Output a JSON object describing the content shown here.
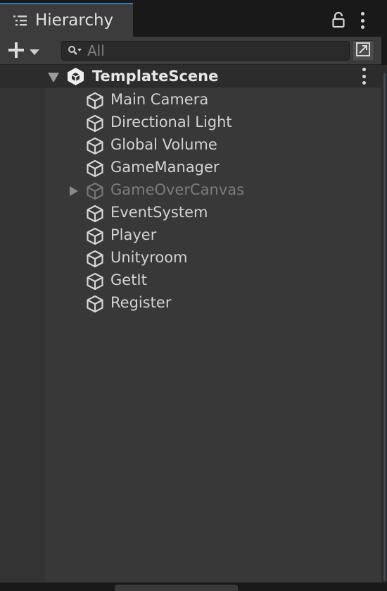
{
  "tab": {
    "title": "Hierarchy",
    "icon": "hierarchy-list-icon"
  },
  "header_icons": {
    "lock": "lock-icon",
    "menu": "kebab-menu-icon"
  },
  "toolbar": {
    "add_icon": "plus-icon",
    "dropdown_icon": "triangle-down-icon",
    "search": {
      "placeholder": "All",
      "value": "",
      "icon": "search-icon"
    },
    "scene_view_icon": "scene-view-icon"
  },
  "scene": {
    "name": "TemplateScene",
    "expanded": true,
    "icon": "unity-scene-icon"
  },
  "objects": [
    {
      "label": "Main Camera",
      "active": true,
      "has_children": false,
      "icon": "gameobject-cube-icon"
    },
    {
      "label": "Directional Light",
      "active": true,
      "has_children": false,
      "icon": "gameobject-cube-icon"
    },
    {
      "label": "Global Volume",
      "active": true,
      "has_children": false,
      "icon": "gameobject-cube-icon"
    },
    {
      "label": "GameManager",
      "active": true,
      "has_children": false,
      "icon": "gameobject-cube-icon"
    },
    {
      "label": "GameOverCanvas",
      "active": false,
      "has_children": true,
      "icon": "gameobject-cube-icon"
    },
    {
      "label": "EventSystem",
      "active": true,
      "has_children": false,
      "icon": "gameobject-cube-icon"
    },
    {
      "label": "Player",
      "active": true,
      "has_children": false,
      "icon": "gameobject-cube-icon"
    },
    {
      "label": "Unityroom",
      "active": true,
      "has_children": false,
      "icon": "gameobject-cube-icon"
    },
    {
      "label": "GetIt",
      "active": true,
      "has_children": false,
      "icon": "gameobject-cube-icon"
    },
    {
      "label": "Register",
      "active": true,
      "has_children": false,
      "icon": "gameobject-cube-icon"
    }
  ],
  "colors": {
    "tab_accent": "#3a79bb",
    "panel_bg": "#383838",
    "text": "#d2d2d2",
    "inactive_text": "#7c7c7c"
  }
}
